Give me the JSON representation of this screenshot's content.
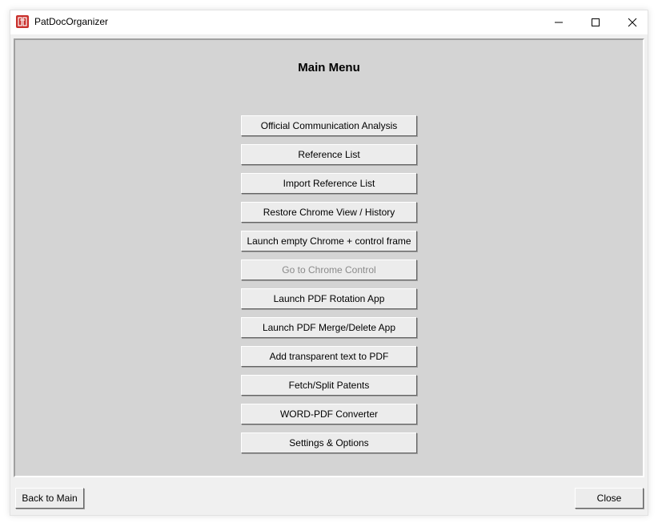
{
  "window": {
    "title": "PatDocOrganizer",
    "icon": "app-logo-icon",
    "accent_color": "#c9302c"
  },
  "main": {
    "heading": "Main Menu",
    "buttons": [
      {
        "label": "Official Communication Analysis",
        "enabled": true
      },
      {
        "label": "Reference List",
        "enabled": true
      },
      {
        "label": "Import Reference List",
        "enabled": true
      },
      {
        "label": "Restore Chrome View / History",
        "enabled": true
      },
      {
        "label": "Launch empty Chrome + control frame",
        "enabled": true
      },
      {
        "label": "Go to Chrome Control",
        "enabled": false
      },
      {
        "label": "Launch PDF Rotation App",
        "enabled": true
      },
      {
        "label": "Launch PDF Merge/Delete App",
        "enabled": true
      },
      {
        "label": "Add transparent text to PDF",
        "enabled": true
      },
      {
        "label": "Fetch/Split Patents",
        "enabled": true
      },
      {
        "label": "WORD-PDF Converter",
        "enabled": true
      },
      {
        "label": "Settings & Options",
        "enabled": true
      }
    ]
  },
  "footer": {
    "back_label": "Back to Main",
    "close_label": "Close"
  }
}
